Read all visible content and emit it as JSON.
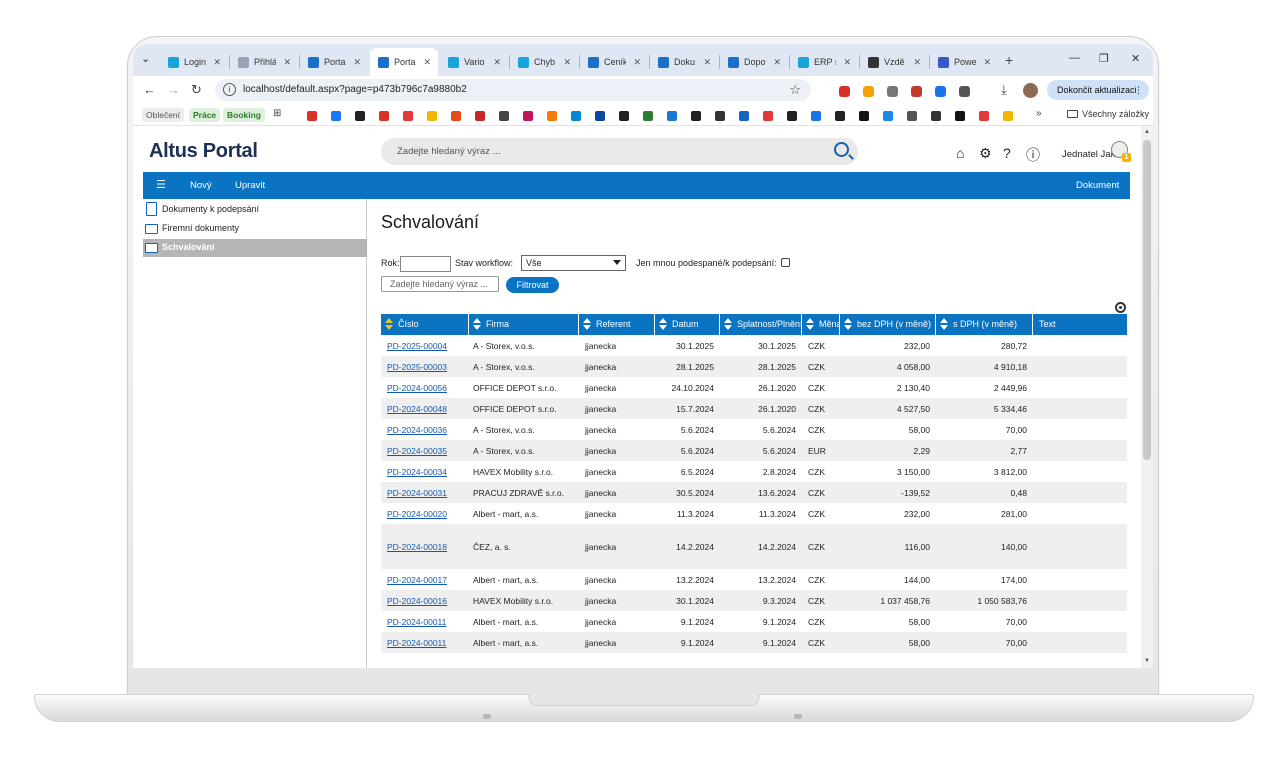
{
  "browser": {
    "tabs": [
      {
        "label": "Login",
        "color": "#1aa3d9"
      },
      {
        "label": "Přihlá",
        "color": "#9aa3b5"
      },
      {
        "label": "Portal",
        "color": "#1a6fc9"
      },
      {
        "label": "Portal",
        "color": "#1a6fc9",
        "active": true
      },
      {
        "label": "Vario",
        "color": "#1aa3d9"
      },
      {
        "label": "Chyb",
        "color": "#1aa3d9"
      },
      {
        "label": "Ceník",
        "color": "#1a6fc9"
      },
      {
        "label": "Doku",
        "color": "#1a6fc9"
      },
      {
        "label": "Dopo",
        "color": "#1a6fc9"
      },
      {
        "label": "ERP s",
        "color": "#1aa3d9"
      },
      {
        "label": "Vzdě",
        "color": "#333333"
      },
      {
        "label": "Powe",
        "color": "#3a57c6"
      }
    ],
    "tab_close": "✕",
    "new_tab": "+",
    "url": "localhost/default.aspx?page=p473b796c7a9880b2",
    "update_button": "Dokončit aktualizaci",
    "bookmarks": {
      "pills": [
        "Oblečení",
        "Práce",
        "Booking"
      ],
      "all_bookmarks": "Všechny záložky",
      "more": "»"
    }
  },
  "app": {
    "logo": "Altus Portal",
    "search_placeholder": "Zadejte hledaný výraz ...",
    "user_name": "Jednatel Jakub",
    "avatar_badge": "1",
    "toolbar": {
      "menu_icon": "☰",
      "new_label": "Nový",
      "edit_label": "Upravit",
      "right_label": "Dokument"
    },
    "sidebar": [
      {
        "label": "Dokumenty k podepsání",
        "icon": "document-icon"
      },
      {
        "label": "Firemní dokumenty",
        "icon": "folder-icon"
      },
      {
        "label": "Schvalování",
        "icon": "folder-icon",
        "selected": true
      }
    ],
    "page_title": "Schvalování",
    "filters": {
      "year_label": "Rok:",
      "year_value": "",
      "workflow_label": "Stav workflow:",
      "workflow_value": "Vše",
      "only_mine_label": "Jen mnou podespané/k podepsání:",
      "search_placeholder": "Zadejte hledaný výraz ...",
      "filter_button": "Filtrovat"
    },
    "grid": {
      "columns": [
        {
          "key": "cislo",
          "label": "Číslo"
        },
        {
          "key": "firma",
          "label": "Firma"
        },
        {
          "key": "referent",
          "label": "Referent"
        },
        {
          "key": "datum",
          "label": "Datum"
        },
        {
          "key": "splatnost",
          "label": "Splatnost/Plnění"
        },
        {
          "key": "mena",
          "label": "Měna"
        },
        {
          "key": "bez_dph",
          "label": "bez DPH (v měně)"
        },
        {
          "key": "s_dph",
          "label": "s DPH (v měně)"
        },
        {
          "key": "text",
          "label": "Text"
        }
      ],
      "rows": [
        {
          "cislo": "PD-2025-00004",
          "firma": "A - Storex, v.o.s.",
          "referent": "jjanecka",
          "datum": "30.1.2025",
          "splatnost": "30.1.2025",
          "mena": "CZK",
          "bez_dph": "232,00",
          "s_dph": "280,72",
          "text": ""
        },
        {
          "cislo": "PD-2025-00003",
          "firma": "A - Storex, v.o.s.",
          "referent": "jjanecka",
          "datum": "28.1.2025",
          "splatnost": "28.1.2025",
          "mena": "CZK",
          "bez_dph": "4 058,00",
          "s_dph": "4 910,18",
          "text": ""
        },
        {
          "cislo": "PD-2024-00056",
          "firma": "OFFICE DEPOT s.r.o.",
          "referent": "jjanecka",
          "datum": "24.10.2024",
          "splatnost": "26.1.2020",
          "mena": "CZK",
          "bez_dph": "2 130,40",
          "s_dph": "2 449,96",
          "text": ""
        },
        {
          "cislo": "PD-2024-00048",
          "firma": "OFFICE DEPOT s.r.o.",
          "referent": "jjanecka",
          "datum": "15.7.2024",
          "splatnost": "26.1.2020",
          "mena": "CZK",
          "bez_dph": "4 527,50",
          "s_dph": "5 334,46",
          "text": ""
        },
        {
          "cislo": "PD-2024-00036",
          "firma": "A - Storex, v.o.s.",
          "referent": "jjanecka",
          "datum": "5.6.2024",
          "splatnost": "5.6.2024",
          "mena": "CZK",
          "bez_dph": "58,00",
          "s_dph": "70,00",
          "text": ""
        },
        {
          "cislo": "PD-2024-00035",
          "firma": "A - Storex, v.o.s.",
          "referent": "jjanecka",
          "datum": "5.6.2024",
          "splatnost": "5.6.2024",
          "mena": "EUR",
          "bez_dph": "2,29",
          "s_dph": "2,77",
          "text": ""
        },
        {
          "cislo": "PD-2024-00034",
          "firma": "HAVEX Mobility s.r.o.",
          "referent": "jjanecka",
          "datum": "6.5.2024",
          "splatnost": "2.8.2024",
          "mena": "CZK",
          "bez_dph": "3 150,00",
          "s_dph": "3 812,00",
          "text": ""
        },
        {
          "cislo": "PD-2024-00031",
          "firma": "PRACUJ ZDRAVĚ s.r.o.",
          "referent": "jjanecka",
          "datum": "30.5.2024",
          "splatnost": "13.6.2024",
          "mena": "CZK",
          "bez_dph": "-139,52",
          "s_dph": "0,48",
          "text": ""
        },
        {
          "cislo": "PD-2024-00020",
          "firma": "Albert - mart, a.s.",
          "referent": "jjanecka",
          "datum": "11.3.2024",
          "splatnost": "11.3.2024",
          "mena": "CZK",
          "bez_dph": "232,00",
          "s_dph": "281,00",
          "text": ""
        },
        {
          "cislo": "PD-2024-00018",
          "firma": "ČEZ, a. s.",
          "referent": "jjanecka",
          "datum": "14.2.2024",
          "splatnost": "14.2.2024",
          "mena": "CZK",
          "bez_dph": "116,00",
          "s_dph": "140,00",
          "text": "",
          "tall": true
        },
        {
          "cislo": "PD-2024-00017",
          "firma": "Albert - mart, a.s.",
          "referent": "jjanecka",
          "datum": "13.2.2024",
          "splatnost": "13.2.2024",
          "mena": "CZK",
          "bez_dph": "144,00",
          "s_dph": "174,00",
          "text": ""
        },
        {
          "cislo": "PD-2024-00016",
          "firma": "HAVEX Mobility s.r.o.",
          "referent": "jjanecka",
          "datum": "30.1.2024",
          "splatnost": "9.3.2024",
          "mena": "CZK",
          "bez_dph": "1 037 458,76",
          "s_dph": "1 050 583,76",
          "text": ""
        },
        {
          "cislo": "PD-2024-00011",
          "firma": "Albert - mart, a.s.",
          "referent": "jjanecka",
          "datum": "9.1.2024",
          "splatnost": "9.1.2024",
          "mena": "CZK",
          "bez_dph": "58,00",
          "s_dph": "70,00",
          "text": ""
        },
        {
          "cislo": "PD-2024-00011",
          "firma": "Albert - mart, a.s.",
          "referent": "jjanecka",
          "datum": "9.1.2024",
          "splatnost": "9.1.2024",
          "mena": "CZK",
          "bez_dph": "58,00",
          "s_dph": "70,00",
          "text": ""
        }
      ]
    }
  }
}
